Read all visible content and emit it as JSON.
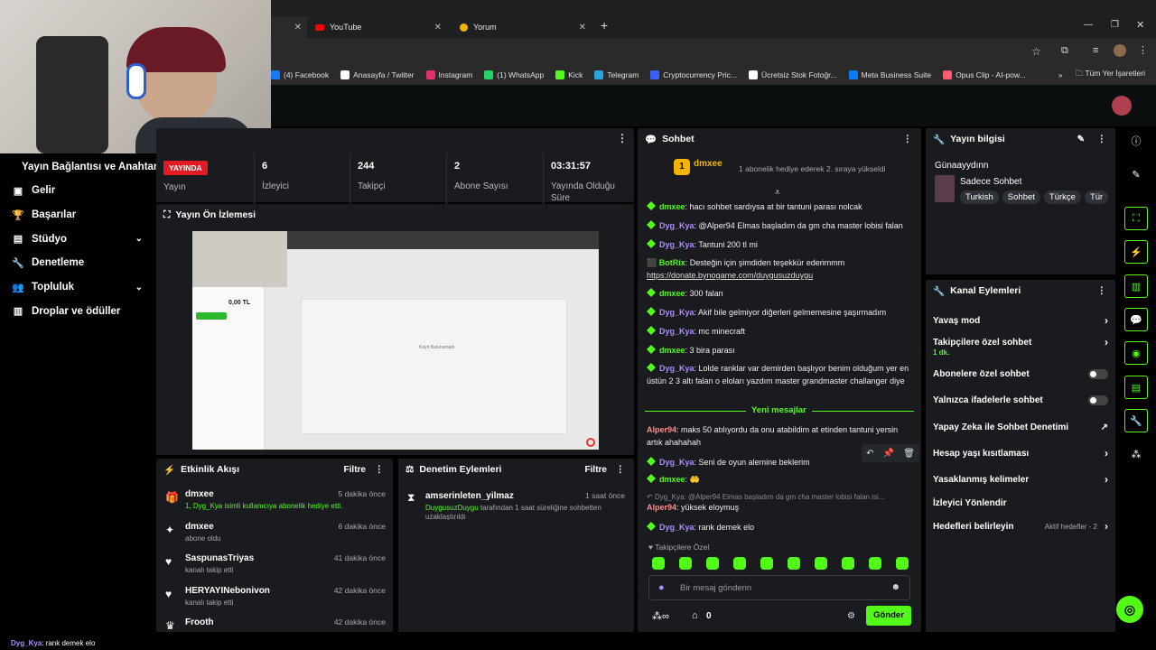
{
  "browser": {
    "tabs": [
      {
        "label": "YouTube"
      },
      {
        "label": "Yorum"
      }
    ],
    "bookmarks": [
      {
        "label": "(4) Facebook",
        "color": "#1877f2"
      },
      {
        "label": "Anasayfa / Twitter",
        "color": "#ffffff"
      },
      {
        "label": "Instagram",
        "color": "#e1306c"
      },
      {
        "label": "(1) WhatsApp",
        "color": "#25d366"
      },
      {
        "label": "Kick",
        "color": "#53fc18"
      },
      {
        "label": "Telegram",
        "color": "#2aa3de"
      },
      {
        "label": "Cryptocurrency Pric...",
        "color": "#3861fb"
      },
      {
        "label": "Ücretsiz Stok Fotoğr...",
        "color": "#ffffff"
      },
      {
        "label": "Meta Business Suite",
        "color": "#0a7cff"
      },
      {
        "label": "Opus Clip - AI-pow...",
        "color": "#ff5b6e"
      }
    ],
    "bookmarks_more": "»",
    "all_bookmarks": "Tüm Yer İşaretleri"
  },
  "leftnav": {
    "title": "Yayın Bağlantısı ve Anahtarı",
    "items": [
      {
        "label": "Gelir",
        "icon": "banknote-icon"
      },
      {
        "label": "Başarılar",
        "icon": "trophy-icon"
      },
      {
        "label": "Stüdyo",
        "icon": "studio-icon"
      },
      {
        "label": "Denetleme",
        "icon": "wrench-icon"
      },
      {
        "label": "Topluluk",
        "icon": "community-icon"
      },
      {
        "label": "Droplar ve ödüller",
        "icon": "drops-icon"
      }
    ]
  },
  "stats": {
    "live_badge": "YAYINDA",
    "live_label": "Yayın",
    "items": [
      {
        "value": "6",
        "label": "İzleyici"
      },
      {
        "value": "244",
        "label": "Takipçi"
      },
      {
        "value": "2",
        "label": "Abone Sayısı"
      },
      {
        "value": "03:31:57",
        "label": "Yayında Olduğu Süre"
      }
    ]
  },
  "preview": {
    "title": "Yayın Ön İzlemesi",
    "mini_price": "0,00 TL",
    "mini_caption": "Kayıt Bulunamadı"
  },
  "activity": {
    "title": "Etkinlik Akışı",
    "filter": "Filtre",
    "events": [
      {
        "name": "dmxee",
        "sub": "1, Dyg_Kya isimli kullanıcıya abonelik hediye etti.",
        "time": "5 dakika önce",
        "icon": "gift-icon"
      },
      {
        "name": "dmxee",
        "sub": "abone oldu",
        "time": "6 dakika önce",
        "icon": "sparkle-icon"
      },
      {
        "name": "SaspunasTriyas",
        "sub": "kanalı takip etti",
        "time": "41 dakika önce",
        "icon": "heart-icon"
      },
      {
        "name": "HERYAYINebonivon",
        "sub": "kanalı takip etti",
        "time": "42 dakika önce",
        "icon": "heart-icon"
      },
      {
        "name": "Frooth",
        "sub": "",
        "time": "42 dakika önce",
        "icon": "crown-icon"
      }
    ]
  },
  "moderation": {
    "title": "Denetim Eylemleri",
    "filter": "Filtre",
    "entry": {
      "name": "amserinleten_yilmaz",
      "time": "1 saat önce",
      "by": "DuygusuzDuygu",
      "text": "tarafından 1 saat süreliğine sohbetten uzaklaştırıldı"
    }
  },
  "chat": {
    "title": "Sohbet",
    "pinned_user": "dmxee",
    "pinned_count": "1",
    "pinned_text": "1 abonelik hediye ederek 2. sıraya yükseldi",
    "messages": [
      {
        "user": "dmxee",
        "text": "hacı sohbet sardıysa at bir tantuni parası nolcak",
        "color": "green"
      },
      {
        "user": "Dyg_Kya",
        "text": "@Alper94 Elmas başladım da gm cha master lobisi falan",
        "color": "purple"
      },
      {
        "user": "Dyg_Kya",
        "text": "Tantuni 200 tl mi",
        "color": "purple"
      },
      {
        "user": "BotRix",
        "text": "Desteğin için şimdiden teşekkür ederimmm",
        "link": "https://donate.bynogame.com/duygusuzduygu",
        "color": "green"
      },
      {
        "user": "dmxee",
        "text": "300 falan",
        "color": "green"
      },
      {
        "user": "Dyg_Kya",
        "text": "Akif bile gelmiyor diğerleri gelmemesine şaşırmadım",
        "color": "purple"
      },
      {
        "user": "Dyg_Kya",
        "text": "mc minecraft",
        "color": "purple"
      },
      {
        "user": "dmxee",
        "text": "3 bira parası",
        "color": "green"
      },
      {
        "user": "Dyg_Kya",
        "text": "Lolde ranklar var demirden başlıyor benim olduğum yer en üstün 2 3 altı falan o eloları yazdım master grandmaster challanger diye",
        "color": "purple"
      }
    ],
    "new_messages": "Yeni mesajlar",
    "messages2": [
      {
        "user": "Alper94",
        "text": "maks 50 atılıyordu da onu atabildim at etinden tantuni yersin artık ahahahah",
        "color": "red"
      },
      {
        "user": "Dyg_Kya",
        "text": "Seni de oyun alemine beklerim",
        "color": "purple"
      },
      {
        "user": "dmxee",
        "text": "",
        "color": "green"
      },
      {
        "user": "Dyg_Kya",
        "text": "@Alper94 Elmas başladım da gm cha master lobisi falan isi...",
        "color": "purple",
        "reply": true
      },
      {
        "user": "Alper94",
        "text": "yüksek eloymuş",
        "color": "red"
      },
      {
        "user": "Dyg_Kya",
        "text": "rank demek elo",
        "color": "purple"
      }
    ],
    "followers_only": "Takipçilere Özel",
    "input_placeholder": "Bir mesaj gönderin",
    "send": "Gönder",
    "count": "0"
  },
  "stream_info": {
    "title": "Yayın bilgisi",
    "channel": "Günaayydınn",
    "category": "Sadece Sohbet",
    "tags": [
      "Turkish",
      "Sohbet",
      "Türkçe",
      "Tür"
    ]
  },
  "channel_actions": {
    "title": "Kanal Eylemleri",
    "rows": [
      {
        "label": "Yavaş mod",
        "type": "chevron"
      },
      {
        "label": "Takipçilere özel sohbet",
        "sub": "1 dk.",
        "type": "chevron"
      },
      {
        "label": "Abonelere özel sohbet",
        "type": "toggle"
      },
      {
        "label": "Yalnızca ifadelerle sohbet",
        "type": "toggle"
      },
      {
        "label": "Yapay Zeka ile Sohbet Denetimi",
        "type": "ext"
      },
      {
        "label": "Hesap yaşı kısıtlaması",
        "type": "chevron"
      },
      {
        "label": "Yasaklanmış kelimeler",
        "type": "chevron"
      },
      {
        "label": "İzleyici Yönlendir",
        "type": "none"
      },
      {
        "label": "Hedefleri belirleyin",
        "sub": "Aktif hedefler - 2",
        "type": "chevron"
      }
    ]
  },
  "bottom_caption": {
    "user": "Dyg_Kya",
    "text": ": rank demek elo"
  },
  "colors": {
    "accent": "#53fc18",
    "panel": "#191b1f",
    "bg": "#000000"
  }
}
